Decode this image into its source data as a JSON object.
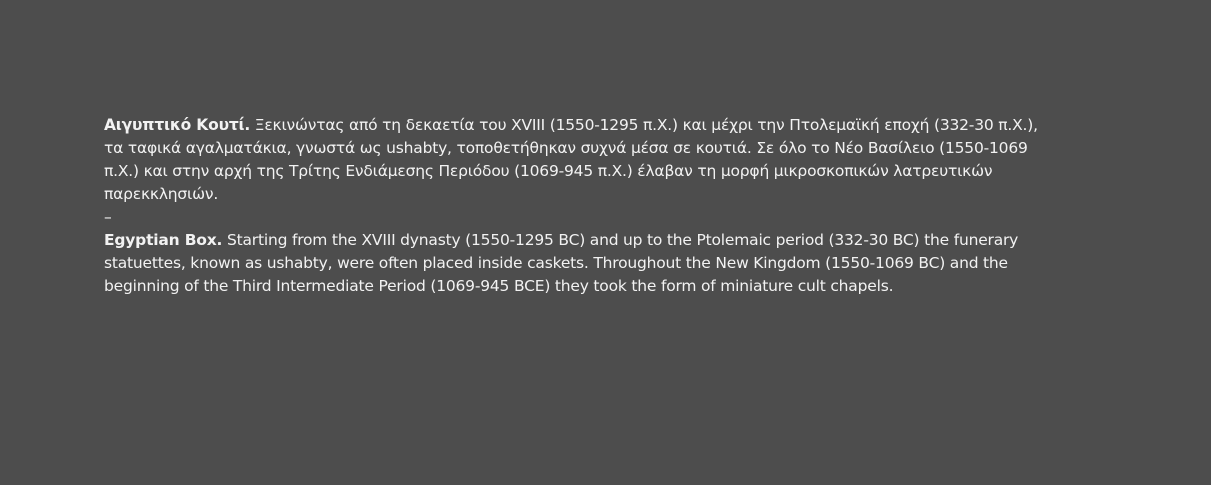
{
  "greek": {
    "title": "Αιγυπτικό Κουτί.",
    "body": " Ξεκινώντας από τη δεκαετία του XVIII (1550-1295 π.Χ.) και μέχρι την Πτολεμαϊκή εποχή (332-30 π.Χ.), τα ταφικά αγαλματάκια, γνωστά ως ushabty, τοποθετήθηκαν συχνά μέσα σε κουτιά. Σε όλο το Νέο Βασίλειο (1550-1069 π.Χ.) και στην αρχή της Τρίτης Ενδιάμεσης Περιόδου (1069-945 π.Χ.) έλαβαν τη μορφή μικροσκοπικών λατρευτικών παρεκκλησιών."
  },
  "separator": "–",
  "english": {
    "title": "Egyptian Box.",
    "body": " Starting from the XVIII dynasty (1550-1295 BC) and up to the Ptolemaic period (332-30 BC) the funerary statuettes, known as ushabty, were often placed inside caskets. Throughout the New Kingdom (1550-1069 BC) and the beginning of the Third Intermediate Period (1069-945 BCE) they took the form of miniature cult chapels."
  }
}
